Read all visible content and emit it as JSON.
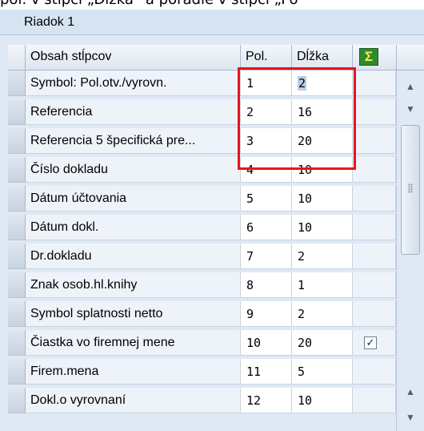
{
  "caption_fragment": "pol. v stĺpci „Dĺžka“ a poradie v stĺpci „Po",
  "panel": {
    "title": "Riadok 1"
  },
  "table": {
    "headers": {
      "name": "Obsah stĺpcov",
      "pol": "Pol.",
      "len": "Dĺžka",
      "sum_icon": "sum-icon"
    },
    "rows": [
      {
        "name": "Symbol: Pol.otv./vyrovn.",
        "pol": "1",
        "len": "2",
        "selected_len": true,
        "sum": false
      },
      {
        "name": "Referencia",
        "pol": "2",
        "len": "16",
        "sum": false
      },
      {
        "name": "Referencia 5 špecifická pre...",
        "pol": "3",
        "len": "20",
        "sum": false
      },
      {
        "name": "Číslo dokladu",
        "pol": "4",
        "len": "10",
        "sum": false
      },
      {
        "name": "Dátum účtovania",
        "pol": "5",
        "len": "10",
        "sum": false
      },
      {
        "name": "Dátum dokl.",
        "pol": "6",
        "len": "10",
        "sum": false
      },
      {
        "name": "Dr.dokladu",
        "pol": "7",
        "len": "2",
        "sum": false
      },
      {
        "name": "Znak osob.hl.knihy",
        "pol": "8",
        "len": "1",
        "sum": false
      },
      {
        "name": "Symbol splatnosti netto",
        "pol": "9",
        "len": "2",
        "sum": false
      },
      {
        "name": "Čiastka vo firemnej mene",
        "pol": "10",
        "len": "20",
        "sum": true
      },
      {
        "name": "Firem.mena",
        "pol": "11",
        "len": "5",
        "sum": false
      },
      {
        "name": "Dokl.o vyrovnaní",
        "pol": "12",
        "len": "10",
        "sum": false
      }
    ]
  },
  "colors": {
    "highlight_box": "#e8141c",
    "panel_bg": "#dfe9f5",
    "selection": "#b9cde6"
  },
  "icons": {
    "scroll_up": "scroll-up-icon",
    "scroll_down": "scroll-down-icon",
    "checkbox": "check-icon"
  }
}
